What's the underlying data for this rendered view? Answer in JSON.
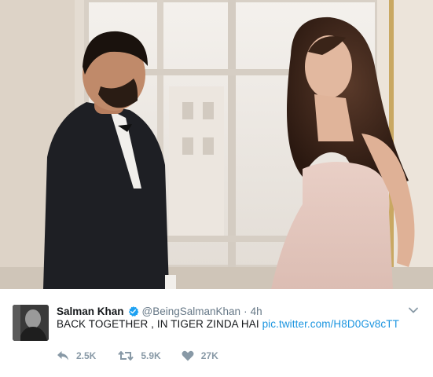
{
  "tweet": {
    "author": {
      "display_name": "Salman Khan",
      "handle": "@BeingSalmanKhan",
      "verified": true
    },
    "separator": "·",
    "timestamp": "4h",
    "text": "BACK TOGETHER , IN TIGER ZINDA HAI",
    "link": "pic.twitter.com/H8D0Gv8cTT",
    "stats": {
      "replies": "2.5K",
      "retweets": "5.9K",
      "likes": "27K"
    }
  },
  "icons": {
    "verified": "verified-badge-icon",
    "reply": "reply-icon",
    "retweet": "retweet-icon",
    "like": "heart-icon",
    "more": "chevron-down-icon"
  },
  "colors": {
    "link": "#1b95e0",
    "verified": "#1da1f2",
    "muted": "#657786",
    "action": "#8899a6"
  }
}
